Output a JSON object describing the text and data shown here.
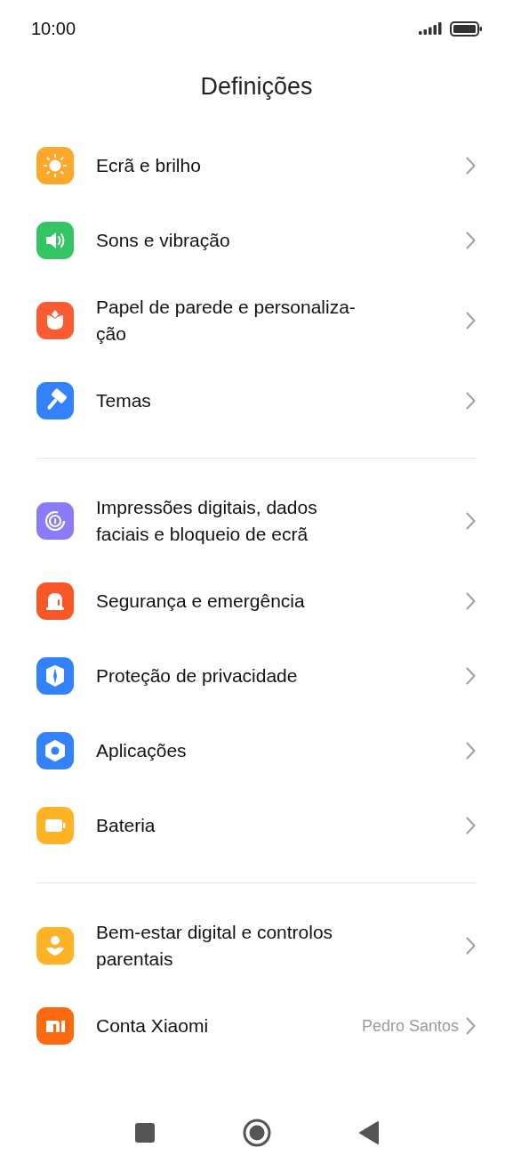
{
  "status_bar": {
    "time": "10:00"
  },
  "title": "Definições",
  "sections": [
    {
      "items": [
        {
          "label": "Ecrã e brilho",
          "kind": "sun",
          "color": "#fda82a"
        },
        {
          "label": "Sons e vibração",
          "kind": "speaker",
          "color": "#33c566"
        },
        {
          "label": "Papel de parede e personaliza-\nção",
          "kind": "tulip",
          "color": "#fa5b30"
        },
        {
          "label": "Temas",
          "kind": "brush",
          "color": "#3482fb"
        }
      ]
    },
    {
      "items": [
        {
          "label": "Impressões digitais, dados\nfaciais e bloqueio de ecrã",
          "kind": "fingerprint",
          "color": "#8a7cf8"
        },
        {
          "label": "Segurança e emergência",
          "kind": "siren",
          "color": "#fa5726"
        },
        {
          "label": "Proteção de privacidade",
          "kind": "shield",
          "color": "#3482fb"
        },
        {
          "label": "Aplicações",
          "kind": "hexagon",
          "color": "#3482fb"
        },
        {
          "label": "Bateria",
          "kind": "battery",
          "color": "#fdb324"
        }
      ]
    },
    {
      "items": [
        {
          "label": "Bem-estar digital e controlos\nparentais",
          "kind": "person",
          "color": "#fdb324"
        },
        {
          "label": "Conta Xiaomi",
          "kind": "mi",
          "color": "#fb6a0e",
          "value": "Pedro Santos"
        }
      ]
    }
  ]
}
